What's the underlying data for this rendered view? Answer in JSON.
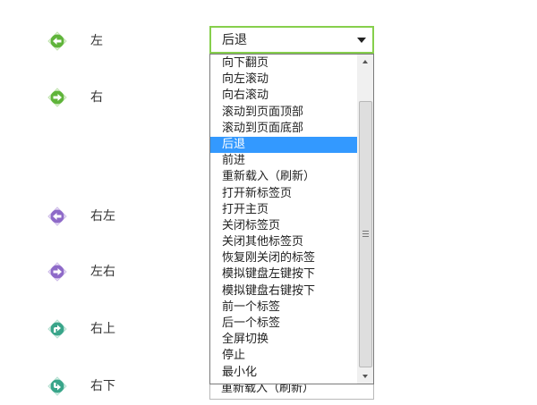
{
  "rows": [
    {
      "label": "左",
      "icon": "arrow-left-icon",
      "color": "#5fb43a"
    },
    {
      "label": "右",
      "icon": "arrow-right-icon",
      "color": "#5fb43a"
    },
    {
      "label": "右左",
      "icon": "arrow-left-icon",
      "color": "#8e6ac8"
    },
    {
      "label": "左右",
      "icon": "arrow-right-icon",
      "color": "#8e6ac8"
    },
    {
      "label": "右上",
      "icon": "arrow-turn-up-icon",
      "color": "#39a58a"
    },
    {
      "label": "右下",
      "icon": "arrow-turn-down-icon",
      "color": "#39a58a"
    }
  ],
  "select": {
    "value": "后退",
    "border_color": "#86cf4c"
  },
  "hidden_select": {
    "value": "重新载入（刷新）"
  },
  "dropdown": {
    "selected_index": 5,
    "highlight_color": "#3399ff",
    "options": [
      "向下翻页",
      "向左滚动",
      "向右滚动",
      "滚动到页面顶部",
      "滚动到页面底部",
      "后退",
      "前进",
      "重新载入（刷新）",
      "打开新标签页",
      "打开主页",
      "关闭标签页",
      "关闭其他标签页",
      "恢复刚关闭的标签",
      "模拟键盘左键按下",
      "模拟键盘右键按下",
      "前一个标签",
      "后一个标签",
      "全屏切换",
      "停止",
      "最小化"
    ]
  }
}
